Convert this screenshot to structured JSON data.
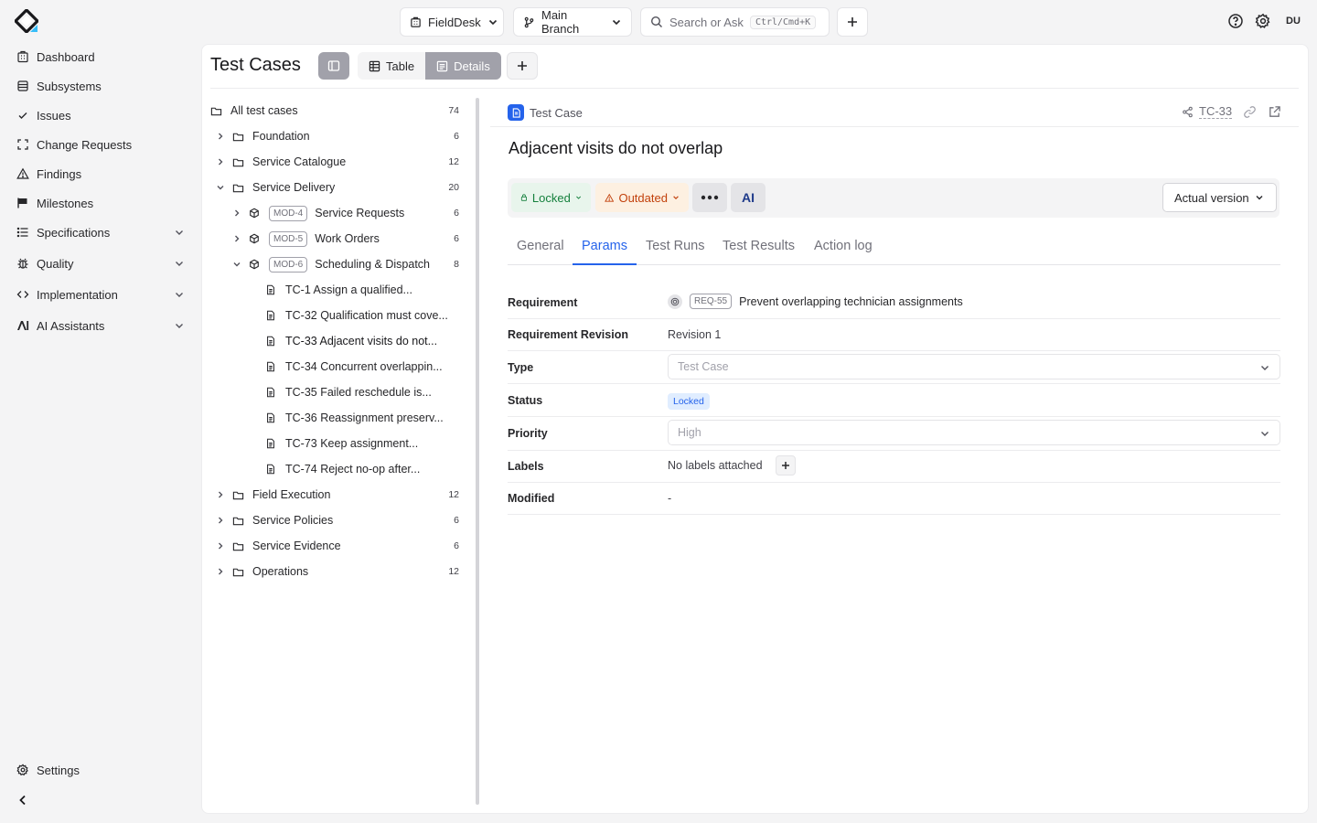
{
  "topbar": {
    "project": "FieldDesk",
    "branch": "Main Branch",
    "search_placeholder": "Search or Ask",
    "search_shortcut": "Ctrl/Cmd+K",
    "user_initials": "DU"
  },
  "sidebar": {
    "items": [
      {
        "label": "Dashboard",
        "icon": "building-icon"
      },
      {
        "label": "Subsystems",
        "icon": "database-icon"
      },
      {
        "label": "Issues",
        "icon": "check-icon"
      },
      {
        "label": "Change Requests",
        "icon": "scan-icon"
      },
      {
        "label": "Findings",
        "icon": "warning-icon"
      },
      {
        "label": "Milestones",
        "icon": "flag-icon"
      },
      {
        "label": "Specifications",
        "icon": "list-icon",
        "expandable": true
      },
      {
        "label": "Quality",
        "icon": "bug-icon",
        "expandable": true
      },
      {
        "label": "Implementation",
        "icon": "code-icon",
        "expandable": true
      },
      {
        "label": "AI Assistants",
        "icon": "ai-icon",
        "expandable": true
      }
    ],
    "settings_label": "Settings"
  },
  "main": {
    "title": "Test Cases",
    "views": [
      "Table",
      "Details"
    ],
    "active_view": "Details"
  },
  "tree": {
    "root": {
      "label": "All test cases",
      "count": "74"
    },
    "folders": [
      {
        "label": "Foundation",
        "count": "6"
      },
      {
        "label": "Service Catalogue",
        "count": "12"
      },
      {
        "label": "Service Delivery",
        "count": "20"
      }
    ],
    "modules": [
      {
        "tag": "MOD-4",
        "label": "Service Requests",
        "count": "6"
      },
      {
        "tag": "MOD-5",
        "label": "Work Orders",
        "count": "6"
      },
      {
        "tag": "MOD-6",
        "label": "Scheduling & Dispatch",
        "count": "8"
      }
    ],
    "cases": [
      "TC-1 Assign a qualified...",
      "TC-32 Qualification must cove...",
      "TC-33 Adjacent visits do not...",
      "TC-34 Concurrent overlappin...",
      "TC-35 Failed reschedule is...",
      "TC-36 Reassignment preserv...",
      "TC-73 Keep assignment...",
      "TC-74 Reject no-op after..."
    ],
    "more_folders": [
      {
        "label": "Field Execution",
        "count": "12"
      },
      {
        "label": "Service Policies",
        "count": "6"
      },
      {
        "label": "Service Evidence",
        "count": "6"
      },
      {
        "label": "Operations",
        "count": "12"
      }
    ]
  },
  "detail": {
    "kind": "Test Case",
    "id": "TC-33",
    "title": "Adjacent visits do not overlap",
    "lock_status": "Locked",
    "sync_status": "Outdated",
    "ai_label": "AI",
    "version": "Actual version",
    "tabs": [
      "General",
      "Params",
      "Test Runs",
      "Test Results",
      "Action log"
    ],
    "active_tab": "Params",
    "params": {
      "requirement_label": "Requirement",
      "requirement_tag": "REQ-55",
      "requirement_value": "Prevent overlapping technician assignments",
      "revision_label": "Requirement Revision",
      "revision_value": "Revision 1",
      "type_label": "Type",
      "type_value": "Test Case",
      "status_label": "Status",
      "status_value": "Locked",
      "priority_label": "Priority",
      "priority_value": "High",
      "labels_label": "Labels",
      "labels_value": "No labels attached",
      "modified_label": "Modified",
      "modified_value": "-"
    }
  },
  "colors": {
    "accent": "#2563eb",
    "locked_green": "#15803d",
    "outdated_orange": "#c2410c"
  }
}
